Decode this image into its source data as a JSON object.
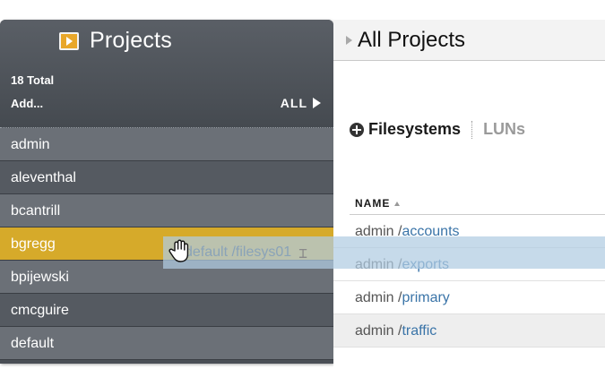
{
  "sidebar": {
    "title": "Projects",
    "icon": "projects-icon",
    "total": "18 Total",
    "add_label": "Add...",
    "all_label": "ALL",
    "items": [
      {
        "label": "admin"
      },
      {
        "label": "aleventhal"
      },
      {
        "label": "bcantrill"
      },
      {
        "label": "bgregg",
        "highlighted": true
      },
      {
        "label": "bpijewski"
      },
      {
        "label": "cmcguire"
      },
      {
        "label": "default"
      }
    ],
    "highlight_color": "#d6aa2a"
  },
  "main": {
    "breadcrumb_title": "All Projects",
    "tabs": [
      {
        "label": "Filesystems",
        "active": true
      },
      {
        "label": "LUNs",
        "active": false
      }
    ],
    "column_header": "NAME",
    "rows": [
      {
        "project": "admin",
        "sep": " /",
        "name": "accounts"
      },
      {
        "project": "admin",
        "sep": " /",
        "name": "exports"
      },
      {
        "project": "admin",
        "sep": " /",
        "name": "primary"
      },
      {
        "project": "admin",
        "sep": " /",
        "name": "traffic"
      }
    ]
  },
  "drag": {
    "text": "default /filesys01"
  },
  "colors": {
    "sidebar_bg": "#4a4f56",
    "link": "#3a74a8",
    "accent": "#e8a72a"
  }
}
